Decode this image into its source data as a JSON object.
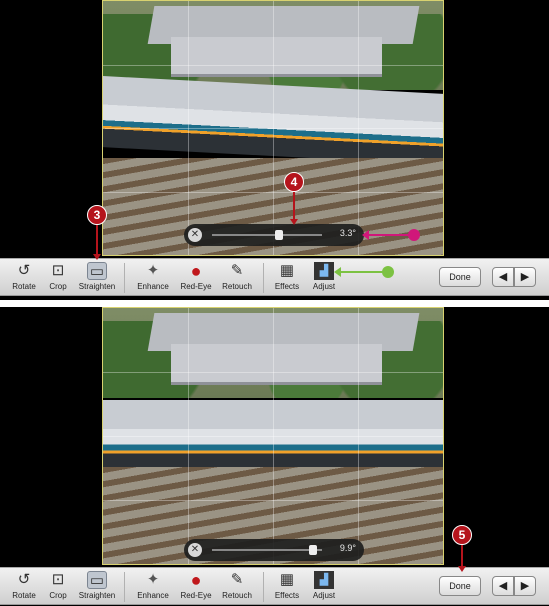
{
  "toolbar": {
    "tools": [
      {
        "label": "Rotate",
        "icon": "rotate-icon"
      },
      {
        "label": "Crop",
        "icon": "crop-icon"
      },
      {
        "label": "Straighten",
        "icon": "straighten-icon"
      },
      {
        "label": "Enhance",
        "icon": "enhance-wand-icon"
      },
      {
        "label": "Red-Eye",
        "icon": "red-eye-icon"
      },
      {
        "label": "Retouch",
        "icon": "retouch-brush-icon"
      },
      {
        "label": "Effects",
        "icon": "effects-grid-icon"
      },
      {
        "label": "Adjust",
        "icon": "adjust-histogram-icon"
      }
    ],
    "done_label": "Done",
    "prev_icon": "arrow-left-icon",
    "next_icon": "arrow-right-icon"
  },
  "top_panel": {
    "straighten_value": "3.3°",
    "straighten_fraction": 0.62,
    "callouts": {
      "tool": "3",
      "slider": "4"
    }
  },
  "bottom_panel": {
    "straighten_value": "9.9°",
    "straighten_fraction": 0.95,
    "callouts": {
      "done": "5"
    }
  },
  "colors": {
    "callout": "#b5141c",
    "pointer_pink": "#d0177a",
    "pointer_green": "#7cc242",
    "grid_border": "#d8d270"
  }
}
